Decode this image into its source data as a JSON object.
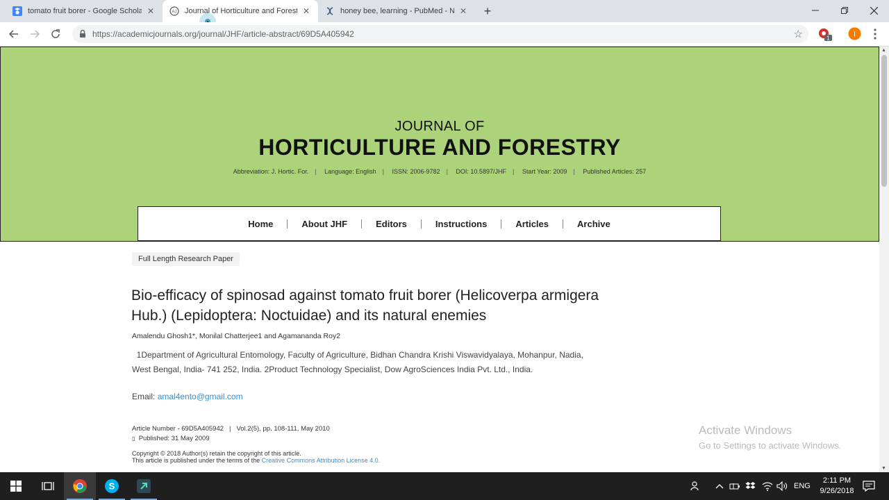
{
  "browser": {
    "tabs": [
      {
        "title": "tomato fruit borer - Google Scholar",
        "favicon": "google-scholar-icon"
      },
      {
        "title": "Journal of Horticulture and Forestry",
        "favicon": "academic-journals-icon"
      },
      {
        "title": "honey bee, learning - PubMed - NCBI",
        "favicon": "pubmed-icon"
      }
    ],
    "new_tab_label": "+",
    "url": "https://academicjournals.org/journal/JHF/article-abstract/69D5A405942",
    "extension_badge": "1",
    "profile_initial": "I"
  },
  "journal": {
    "prefix": "JOURNAL OF",
    "name": "HORTICULTURE AND FORESTRY",
    "meta": [
      "Abbreviation: J. Hortic. For.",
      "Language: English",
      "ISSN: 2006-9782",
      "DOI: 10.5897/JHF",
      "Start Year: 2009",
      "Published Articles: 257"
    ]
  },
  "nav": [
    "Home",
    "About JHF",
    "Editors",
    "Instructions",
    "Articles",
    "Archive"
  ],
  "article": {
    "type": "Full Length Research Paper",
    "title": "Bio-efficacy of spinosad against tomato fruit borer (Helicoverpa armigera Hub.) (Lepidoptera: Noctuidae) and its natural enemies",
    "authors": "Amalendu Ghosh1*, Monilal Chatterjee1 and Agamananda Roy2",
    "affiliation": "1Department of Agricultural Entomology, Faculty of Agriculture, Bidhan Chandra Krishi Viswavidyalaya, Mohanpur, Nadia, West Bengal, India- 741 252, India. 2Product Technology Specialist, Dow AgroSciences India Pvt. Ltd., India.",
    "email_label": "Email: ",
    "email": "amal4ento@gmail.com",
    "article_number": "Article Number - 69D5A405942",
    "volume": "Vol.2(5), pp. 108-111, May 2010",
    "published": "Published: 31 May 2009",
    "copyright": "Copyright © 2018 Author(s) retain the copyright of this article.",
    "license_prefix": "This article is published under the terms of the ",
    "license_link": "Creative Commons Attribution License 4.0."
  },
  "watermark": {
    "line1": "Activate Windows",
    "line2": "Go to Settings to activate Windows."
  },
  "taskbar": {
    "language": "ENG",
    "time": "2:11 PM",
    "date": "9/26/2018"
  },
  "colors": {
    "banner": "#acd379",
    "link": "#3a8fd1",
    "tabstrip": "#dee1e6",
    "taskbar": "#1f1f1f"
  }
}
